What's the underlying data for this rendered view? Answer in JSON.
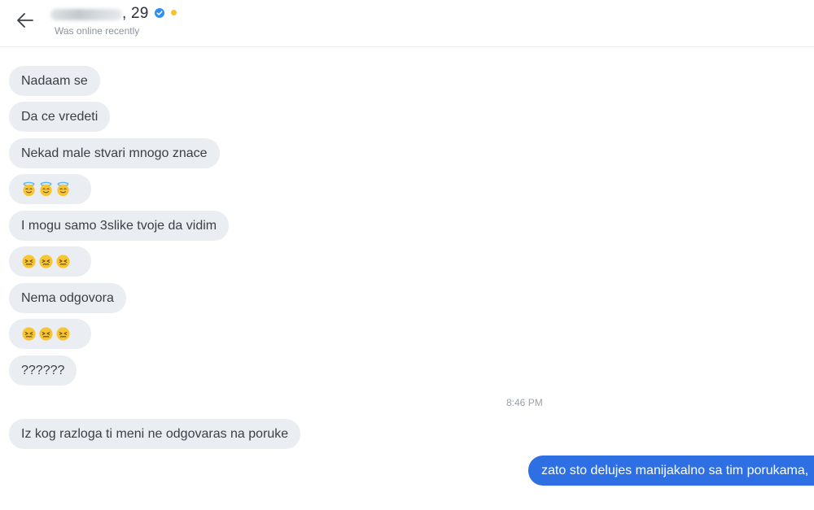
{
  "header": {
    "age_suffix": ", 29",
    "status": "Was online recently",
    "icons": {
      "back": "arrow-left-icon",
      "verified": "verified-badge-icon",
      "online": "online-dot-icon"
    }
  },
  "messages": {
    "m1": "Nadaam se",
    "m2": "Da ce vredeti",
    "m3": "Nekad male stvari mnogo znace",
    "m4_emoji": "😇😇😇",
    "m5": "I mogu samo 3slike tvoje da vidim",
    "m6_emoji": "😖😖😖",
    "m7": "Nema odgovora",
    "m8_emoji": "😖😖😖",
    "m9": "??????",
    "timestamp": "8:46 PM",
    "m10": "Iz kog razloga ti meni ne odgovaras na poruke",
    "outgoing": "zato sto delujes manijakalno sa tim porukama,"
  },
  "colors": {
    "incoming_bubble": "#eaedf1",
    "outgoing_bubble": "#2f6fe4",
    "verified": "#2f8ff0",
    "online": "#f6c034"
  }
}
